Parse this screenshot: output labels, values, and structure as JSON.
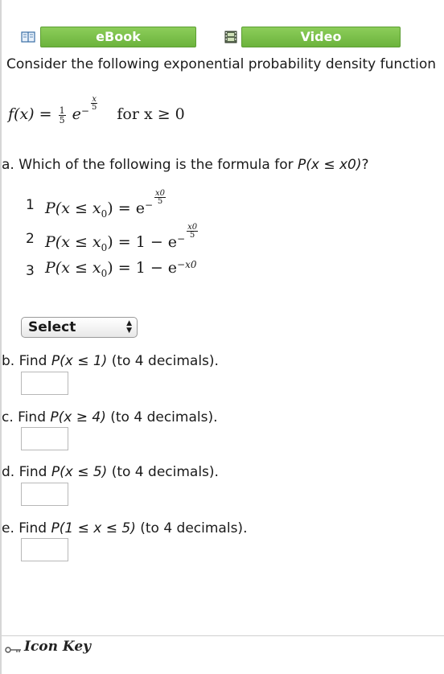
{
  "toolbar": {
    "ebook_label": "eBook",
    "video_label": "Video",
    "button_color": "#7cc24a"
  },
  "intro_text": "Consider the following exponential probability density function",
  "pdf": {
    "lhs": "f(x) =",
    "coef_num": "1",
    "coef_den": "5",
    "base": "e",
    "exp_sign": "−",
    "exp_num": "x",
    "exp_den": "5",
    "condition": "for  x ≥ 0"
  },
  "questions": {
    "a": {
      "label": "a. Which of the following is the formula for ",
      "expr": "P(x ≤ x0)",
      "end": "?"
    },
    "b": {
      "label": "b. Find ",
      "expr": "P(x ≤ 1)",
      "end": " (to 4 decimals)."
    },
    "c": {
      "label": "c. Find ",
      "expr": "P(x ≥ 4)",
      "end": " (to 4 decimals)."
    },
    "d": {
      "label": "d. Find ",
      "expr": "P(x ≤ 5)",
      "end": " (to 4 decimals)."
    },
    "e": {
      "label": "e. Find ",
      "expr": "P(1 ≤ x ≤ 5)",
      "end": " (to 4 decimals)."
    }
  },
  "options": [
    {
      "num": "1",
      "lhs": "P(x ≤ x",
      "sub": "0",
      "rhs": ") = e",
      "exp_sign": "−",
      "exp_num": "x0",
      "exp_den": "5"
    },
    {
      "num": "2",
      "lhs": "P(x ≤ x",
      "sub": "0",
      "rhs": ") = 1 − e",
      "exp_sign": "−",
      "exp_num": "x0",
      "exp_den": "5"
    },
    {
      "num": "3",
      "lhs": "P(x ≤ x",
      "sub": "0",
      "rhs": ") = 1 − e",
      "exp": "−x0"
    }
  ],
  "select": {
    "value": "Select"
  },
  "answers": {
    "b": "",
    "c": "",
    "d": "",
    "e": ""
  },
  "footer": {
    "icon_key_label": "Icon Key"
  }
}
